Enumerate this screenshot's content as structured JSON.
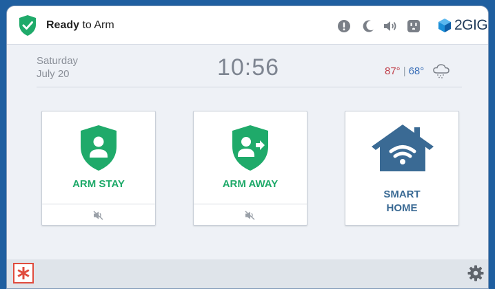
{
  "header": {
    "status_strong": "Ready",
    "status_rest": " to Arm",
    "brand": "2GIG",
    "icons": [
      "alert-icon",
      "moon-icon",
      "speaker-icon",
      "outlet-icon"
    ]
  },
  "info": {
    "day": "Saturday",
    "date": "July 20",
    "time": "10:56",
    "temp_high": "87°",
    "temp_sep": "|",
    "temp_low": "68°"
  },
  "tiles": [
    {
      "label": "ARM STAY",
      "icon": "shield-person-icon"
    },
    {
      "label": "ARM AWAY",
      "icon": "shield-person-arrow-icon"
    },
    {
      "label_line1": "SMART",
      "label_line2": "HOME",
      "icon": "house-wifi-icon"
    }
  ],
  "colors": {
    "accent_green": "#1faa6a",
    "temp_high": "#c0414b",
    "temp_low": "#3a6fb8",
    "smart_blue": "#3a6a94",
    "emergency_red": "#e04b3d",
    "frame_blue": "#1f5fa0"
  }
}
